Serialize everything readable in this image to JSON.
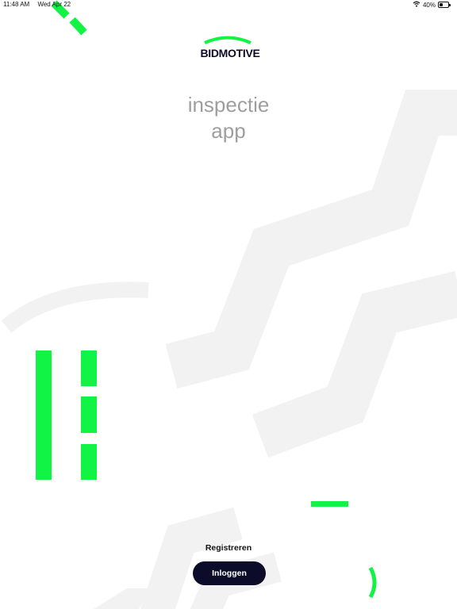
{
  "status_bar": {
    "time": "11:48 AM",
    "date": "Wed Apr 22",
    "battery": "40%",
    "icons": [
      "wifi-icon",
      "battery-icon"
    ]
  },
  "logo": {
    "text": "BIDMOTIVE"
  },
  "title": {
    "line1": "inspectie",
    "line2": "app"
  },
  "actions": {
    "register_label": "Registreren",
    "login_label": "Inloggen"
  },
  "colors": {
    "accent_green": "#12f445",
    "navy": "#0c0c2a",
    "background_shape": "#f2f2f2",
    "title_gray": "#9e9e9e"
  }
}
